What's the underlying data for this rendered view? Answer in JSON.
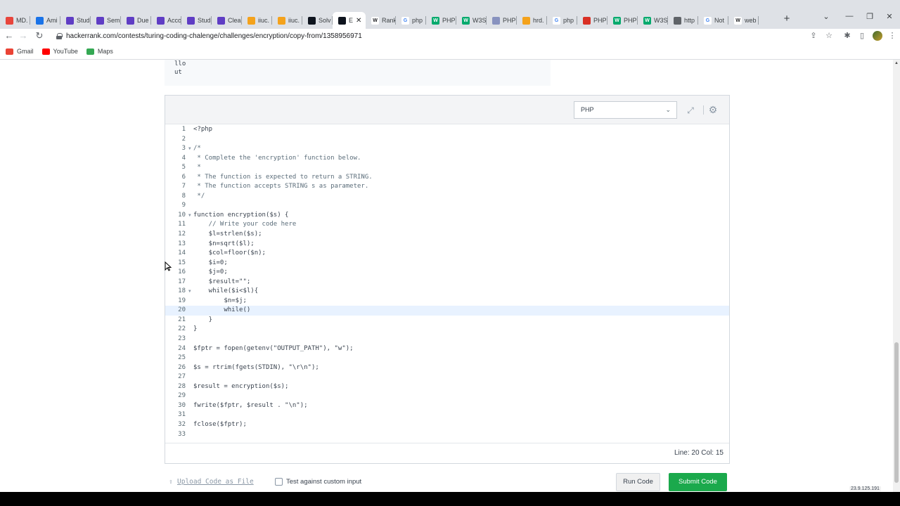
{
  "browser": {
    "tabs": [
      {
        "title": "MD.",
        "color": "#e8453c",
        "glyph": ""
      },
      {
        "title": "Ami",
        "color": "#1a73e8",
        "glyph": ""
      },
      {
        "title": "Stud",
        "color": "#5f3dc4",
        "glyph": ""
      },
      {
        "title": "Sem",
        "color": "#5f3dc4",
        "glyph": ""
      },
      {
        "title": "Due",
        "color": "#5f3dc4",
        "glyph": ""
      },
      {
        "title": "Acco",
        "color": "#5f3dc4",
        "glyph": ""
      },
      {
        "title": "Stud",
        "color": "#5f3dc4",
        "glyph": ""
      },
      {
        "title": "Clea",
        "color": "#5f3dc4",
        "glyph": ""
      },
      {
        "title": "iiuc.",
        "color": "#f4a21c",
        "glyph": ""
      },
      {
        "title": "iiuc.",
        "color": "#f4a21c",
        "glyph": ""
      },
      {
        "title": "Solv",
        "color": "#0e141e",
        "glyph": ""
      },
      {
        "title": "E",
        "color": "#0e141e",
        "glyph": "",
        "active": true
      },
      {
        "title": "Rank",
        "color": "#ffffff",
        "glyph": "W"
      },
      {
        "title": "php",
        "color": "#ffffff",
        "glyph": "G"
      },
      {
        "title": "PHP",
        "color": "#04aa6d",
        "glyph": "W"
      },
      {
        "title": "W3S",
        "color": "#04aa6d",
        "glyph": "W"
      },
      {
        "title": "PHP",
        "color": "#8892bf",
        "glyph": ""
      },
      {
        "title": "hrd.",
        "color": "#f4a21c",
        "glyph": ""
      },
      {
        "title": "php",
        "color": "#ffffff",
        "glyph": "G"
      },
      {
        "title": "PHP",
        "color": "#d93025",
        "glyph": ""
      },
      {
        "title": "PHP",
        "color": "#04aa6d",
        "glyph": "W"
      },
      {
        "title": "W3S",
        "color": "#04aa6d",
        "glyph": "W"
      },
      {
        "title": "http",
        "color": "#5f6368",
        "glyph": ""
      },
      {
        "title": "Not",
        "color": "#ffffff",
        "glyph": "G"
      },
      {
        "title": "web",
        "color": "#ffffff",
        "glyph": "W"
      }
    ],
    "url": "hackerrank.com/contests/turing-coding-chalenge/challenges/encryption/copy-from/1358956971",
    "bookmarks": [
      {
        "label": "Gmail",
        "color": "#ea4335"
      },
      {
        "label": "YouTube",
        "color": "#ff0000"
      },
      {
        "label": "Maps",
        "color": "#34a853"
      }
    ]
  },
  "sample_output": [
    "llo",
    "ut"
  ],
  "editor": {
    "language": "PHP",
    "lines": [
      {
        "n": "1",
        "text": "<?php",
        "fold": false,
        "comment": false
      },
      {
        "n": "2",
        "text": "",
        "fold": false,
        "comment": false
      },
      {
        "n": "3",
        "text": "/*",
        "fold": true,
        "comment": true
      },
      {
        "n": "4",
        "text": " * Complete the 'encryption' function below.",
        "fold": false,
        "comment": true
      },
      {
        "n": "5",
        "text": " *",
        "fold": false,
        "comment": true
      },
      {
        "n": "6",
        "text": " * The function is expected to return a STRING.",
        "fold": false,
        "comment": true
      },
      {
        "n": "7",
        "text": " * The function accepts STRING s as parameter.",
        "fold": false,
        "comment": true
      },
      {
        "n": "8",
        "text": " */",
        "fold": false,
        "comment": true
      },
      {
        "n": "9",
        "text": "",
        "fold": false,
        "comment": false
      },
      {
        "n": "10",
        "text": "function encryption($s) {",
        "fold": true,
        "comment": false
      },
      {
        "n": "11",
        "text": "    // Write your code here",
        "fold": false,
        "comment": true
      },
      {
        "n": "12",
        "text": "    $l=strlen($s);",
        "fold": false,
        "comment": false
      },
      {
        "n": "13",
        "text": "    $n=sqrt($l);",
        "fold": false,
        "comment": false
      },
      {
        "n": "14",
        "text": "    $col=floor($n);",
        "fold": false,
        "comment": false
      },
      {
        "n": "15",
        "text": "    $i=0;",
        "fold": false,
        "comment": false
      },
      {
        "n": "16",
        "text": "    $j=0;",
        "fold": false,
        "comment": false
      },
      {
        "n": "17",
        "text": "    $result=\"\";",
        "fold": false,
        "comment": false
      },
      {
        "n": "18",
        "text": "    while($i<$l){",
        "fold": true,
        "comment": false
      },
      {
        "n": "19",
        "text": "        $n=$j;",
        "fold": false,
        "comment": false
      },
      {
        "n": "20",
        "text": "        while()",
        "fold": false,
        "comment": false,
        "active": true
      },
      {
        "n": "21",
        "text": "    }",
        "fold": false,
        "comment": false
      },
      {
        "n": "22",
        "text": "}",
        "fold": false,
        "comment": false
      },
      {
        "n": "23",
        "text": "",
        "fold": false,
        "comment": false
      },
      {
        "n": "24",
        "text": "$fptr = fopen(getenv(\"OUTPUT_PATH\"), \"w\");",
        "fold": false,
        "comment": false
      },
      {
        "n": "25",
        "text": "",
        "fold": false,
        "comment": false
      },
      {
        "n": "26",
        "text": "$s = rtrim(fgets(STDIN), \"\\r\\n\");",
        "fold": false,
        "comment": false
      },
      {
        "n": "27",
        "text": "",
        "fold": false,
        "comment": false
      },
      {
        "n": "28",
        "text": "$result = encryption($s);",
        "fold": false,
        "comment": false
      },
      {
        "n": "29",
        "text": "",
        "fold": false,
        "comment": false
      },
      {
        "n": "30",
        "text": "fwrite($fptr, $result . \"\\n\");",
        "fold": false,
        "comment": false
      },
      {
        "n": "31",
        "text": "",
        "fold": false,
        "comment": false
      },
      {
        "n": "32",
        "text": "fclose($fptr);",
        "fold": false,
        "comment": false
      },
      {
        "n": "33",
        "text": "",
        "fold": false,
        "comment": false
      }
    ],
    "status": "Line: 20 Col: 15"
  },
  "actions": {
    "upload_label": "Upload Code as File",
    "custom_input_label": "Test against custom input",
    "custom_input_checked": false,
    "run_label": "Run Code",
    "submit_label": "Submit Code"
  },
  "corner_label": "23.9.125.191",
  "colors": {
    "submit": "#1ba94c",
    "active_line": "#e8f2ff"
  }
}
